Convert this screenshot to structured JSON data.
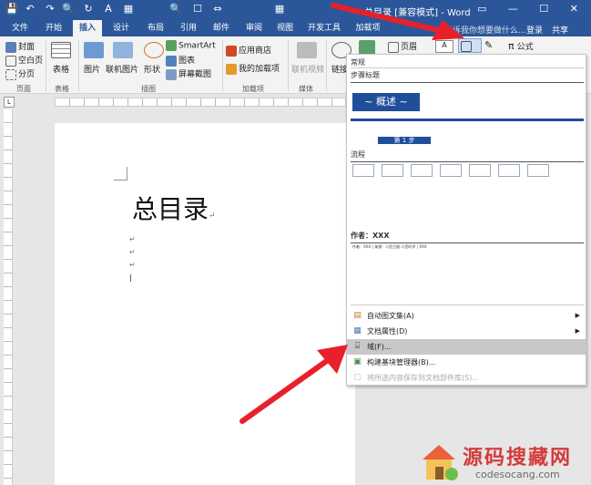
{
  "window": {
    "title": "总目录 [兼容模式] - Word",
    "controls": "▭ — ☐ ✕"
  },
  "quick_access": [
    "💾",
    "↶",
    "↷",
    "🔍",
    "↻",
    "A",
    "▦",
    "🔍",
    "☐",
    "⇔",
    "▦"
  ],
  "tabs": [
    "文件",
    "开始",
    "插入",
    "设计",
    "布局",
    "引用",
    "邮件",
    "审阅",
    "视图",
    "开发工具",
    "加载项"
  ],
  "active_tab": "插入",
  "tell_me": "告诉我你想要做什么...",
  "account": {
    "login": "登录",
    "share": "共享"
  },
  "ribbon": {
    "pages_group": {
      "cover": "封面",
      "blank": "空白页",
      "break": "分页",
      "label": "页面"
    },
    "tables_group": {
      "table": "表格",
      "label": "表格"
    },
    "illustrations_group": {
      "pictures": "图片",
      "online_pictures": "联机图片",
      "shapes": "形状",
      "smartart": "SmartArt",
      "chart": "图表",
      "screenshot": "屏幕截图",
      "label": "插图"
    },
    "addins_group": {
      "store": "应用商店",
      "my_addins": "我的加载项",
      "label": "加载项"
    },
    "media_group": {
      "online_video": "联机视频",
      "label": "媒体"
    },
    "links_group": {
      "link": "链接"
    },
    "header_btn": "页眉",
    "equation_btn": "公式",
    "equation_symbol": "π"
  },
  "document": {
    "heading": "总目录",
    "para_mark": "↵"
  },
  "dropdown": {
    "top_label": "常规",
    "sections": [
      {
        "title": "步骤标题",
        "preview_text": "~ 概述 ~",
        "preview_text2": "第 1 步"
      },
      {
        "title": "流程"
      },
      {
        "title": "作者：XXX",
        "preview_text": "作者：XXX  |  来源：人民日报·人民时评  |  XXX"
      }
    ],
    "menu": [
      {
        "icon": "autotext-icon",
        "label": "自动图文集(A)",
        "has_arrow": true,
        "highlight": false,
        "disabled": false
      },
      {
        "icon": "doc-property-icon",
        "label": "文档属性(D)",
        "has_arrow": true,
        "highlight": false,
        "disabled": false
      },
      {
        "icon": "field-icon",
        "label": "域(F)...",
        "has_arrow": false,
        "highlight": true,
        "disabled": false
      },
      {
        "icon": "building-blocks-icon",
        "label": "构建基块管理器(B)...",
        "has_arrow": false,
        "highlight": false,
        "disabled": false
      },
      {
        "icon": "save-selection-icon",
        "label": "将所选内容保存到文档部件库(S)...",
        "has_arrow": false,
        "highlight": false,
        "disabled": true
      }
    ]
  },
  "watermark": {
    "title": "源码搜藏网",
    "url": "codesocang.com"
  },
  "colors": {
    "brand": "#2b579a",
    "arrow": "#e8202a",
    "watermark_text": "#d43a3a"
  }
}
